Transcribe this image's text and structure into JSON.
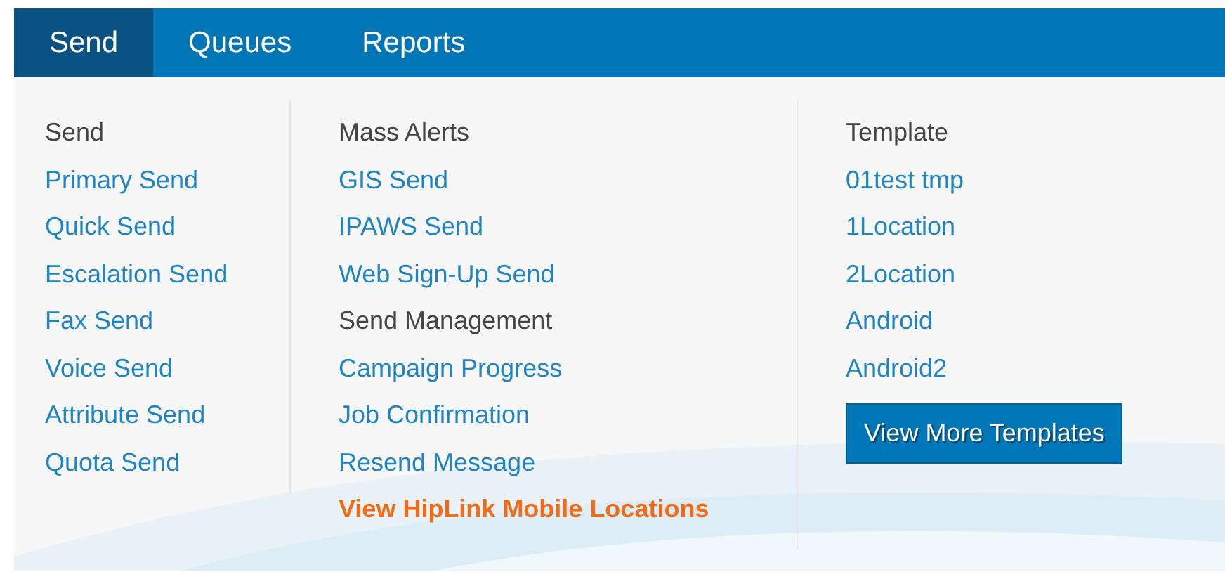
{
  "tabs": [
    {
      "label": "Send",
      "selected": true
    },
    {
      "label": "Queues",
      "selected": false
    },
    {
      "label": "Reports",
      "selected": false
    }
  ],
  "columns": [
    {
      "items": [
        {
          "kind": "heading",
          "text": "Send"
        },
        {
          "kind": "link",
          "text": "Primary Send"
        },
        {
          "kind": "link",
          "text": "Quick Send"
        },
        {
          "kind": "link",
          "text": "Escalation Send"
        },
        {
          "kind": "link",
          "text": "Fax Send"
        },
        {
          "kind": "link",
          "text": "Voice Send"
        },
        {
          "kind": "link",
          "text": "Attribute Send"
        },
        {
          "kind": "link",
          "text": "Quota Send"
        }
      ]
    },
    {
      "items": [
        {
          "kind": "heading",
          "text": "Mass Alerts"
        },
        {
          "kind": "link",
          "text": "GIS Send"
        },
        {
          "kind": "link",
          "text": "IPAWS Send"
        },
        {
          "kind": "link",
          "text": "Web Sign-Up Send"
        },
        {
          "kind": "heading",
          "text": "Send Management"
        },
        {
          "kind": "link",
          "text": "Campaign Progress"
        },
        {
          "kind": "link",
          "text": "Job Confirmation"
        },
        {
          "kind": "link",
          "text": "Resend Message"
        },
        {
          "kind": "highlight",
          "text": "View HipLink Mobile Locations"
        }
      ]
    },
    {
      "items": [
        {
          "kind": "heading",
          "text": "Template"
        },
        {
          "kind": "link",
          "text": "01test tmp"
        },
        {
          "kind": "link",
          "text": "1Location"
        },
        {
          "kind": "link",
          "text": "2Location"
        },
        {
          "kind": "link",
          "text": "Android"
        },
        {
          "kind": "link",
          "text": "Android2"
        },
        {
          "kind": "button",
          "text": "View More Templates"
        }
      ]
    }
  ]
}
